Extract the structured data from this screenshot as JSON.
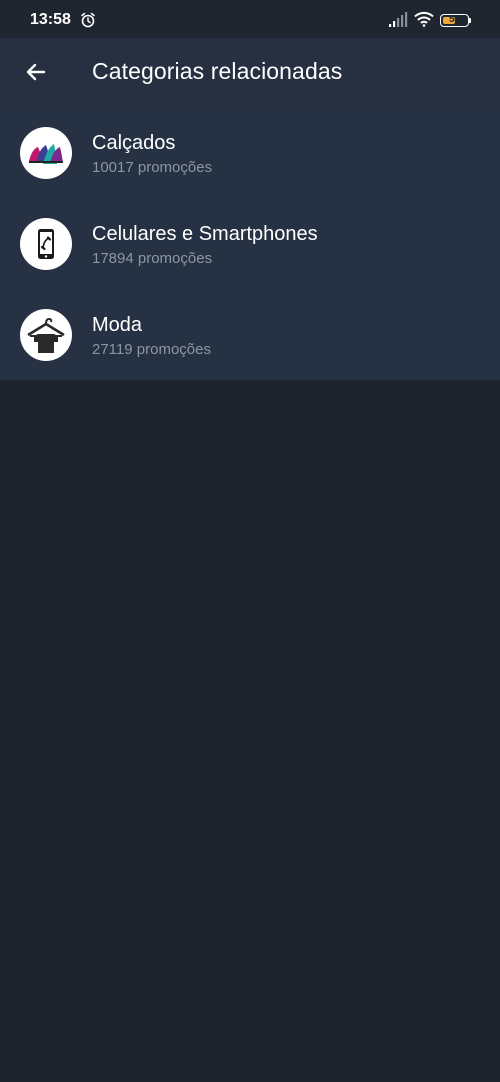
{
  "status_bar": {
    "time": "13:58",
    "battery": "54",
    "icons": [
      "alarm-icon",
      "signal-icon",
      "wifi-icon",
      "battery-icon"
    ]
  },
  "app_bar": {
    "title": "Categorias relacionadas",
    "back_icon": "arrow-left-icon"
  },
  "categories": [
    {
      "title": "Calçados",
      "subtitle": "10017 promoções",
      "icon": "shoes-image"
    },
    {
      "title": "Celulares e Smartphones",
      "subtitle": "17894 promoções",
      "icon": "smartphone-icon"
    },
    {
      "title": "Moda",
      "subtitle": "27119 promoções",
      "icon": "hanger-shirt-icon"
    }
  ],
  "colors": {
    "background": "#1e242e",
    "app_bar": "#263040",
    "list": "#263244",
    "subtitle": "#8b96a5",
    "battery_fill": "#f0a93a"
  }
}
